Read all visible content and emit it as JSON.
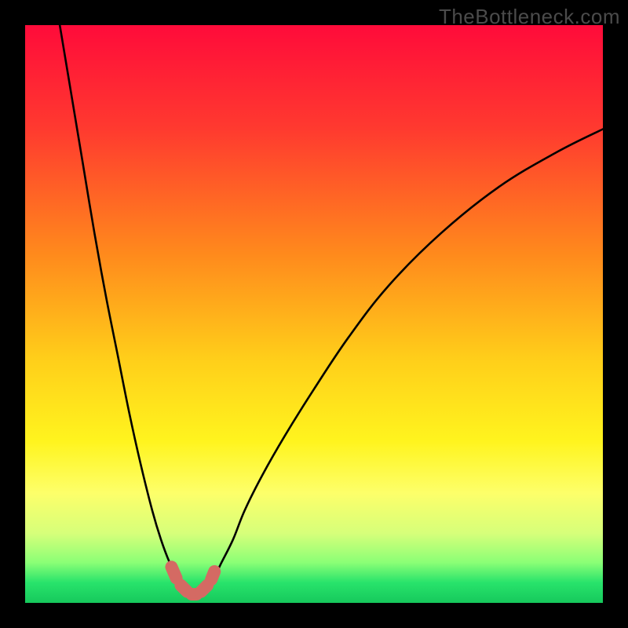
{
  "watermark": "TheBottleneck.com",
  "chart_data": {
    "type": "line",
    "title": "",
    "xlabel": "",
    "ylabel": "",
    "xlim": [
      0,
      100
    ],
    "ylim": [
      0,
      100
    ],
    "grid": false,
    "legend": false,
    "gradient_stops": [
      {
        "offset": 0.0,
        "color": "#ff0b3a"
      },
      {
        "offset": 0.18,
        "color": "#ff3a2f"
      },
      {
        "offset": 0.4,
        "color": "#ff8b1c"
      },
      {
        "offset": 0.58,
        "color": "#ffcf1a"
      },
      {
        "offset": 0.72,
        "color": "#fff41e"
      },
      {
        "offset": 0.81,
        "color": "#fdff6a"
      },
      {
        "offset": 0.88,
        "color": "#d6ff7a"
      },
      {
        "offset": 0.93,
        "color": "#8bff76"
      },
      {
        "offset": 0.965,
        "color": "#28e36b"
      },
      {
        "offset": 1.0,
        "color": "#16c95c"
      }
    ],
    "series": [
      {
        "name": "bottleneck-left-arm",
        "x": [
          6,
          8,
          10,
          12,
          14,
          16,
          18,
          20,
          22,
          23.5,
          25,
          26.5,
          27.5
        ],
        "values": [
          100,
          88,
          76,
          64,
          53,
          43,
          33,
          24,
          16,
          11,
          7,
          4,
          2
        ]
      },
      {
        "name": "bottleneck-right-arm",
        "x": [
          31,
          32.5,
          34,
          36,
          38,
          41,
          45,
          50,
          56,
          63,
          72,
          82,
          92,
          100
        ],
        "values": [
          2,
          4,
          7,
          11,
          16,
          22,
          29,
          37,
          46,
          55,
          64,
          72,
          78,
          82
        ]
      }
    ],
    "valley_points": [
      {
        "x": 25.0,
        "y": 7.0
      },
      {
        "x": 26.5,
        "y": 3.5
      },
      {
        "x": 28.5,
        "y": 1.5
      },
      {
        "x": 30.0,
        "y": 1.5
      },
      {
        "x": 32.0,
        "y": 3.5
      },
      {
        "x": 33.0,
        "y": 6.0
      }
    ]
  }
}
